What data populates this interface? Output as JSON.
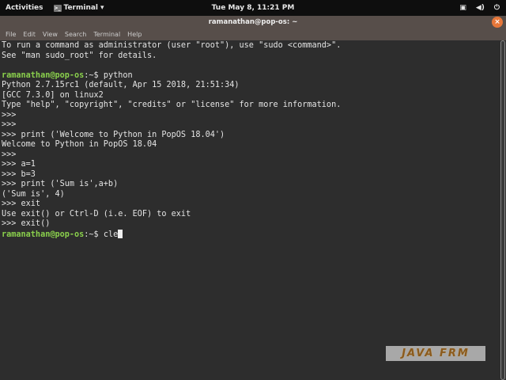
{
  "topbar": {
    "activities": "Activities",
    "app": "Terminal",
    "clock": "Tue May 8, 11:21 PM"
  },
  "window": {
    "title": "ramanathan@pop-os: ~",
    "close": "×"
  },
  "menu": [
    "File",
    "Edit",
    "View",
    "Search",
    "Terminal",
    "Help"
  ],
  "terminal": {
    "prompt": "ramanathan@pop-os",
    "lines": [
      "To run a command as administrator (user \"root\"), use \"sudo <command>\".",
      "See \"man sudo_root\" for details.",
      "",
      "Python 2.7.15rc1 (default, Apr 15 2018, 21:51:34)",
      "[GCC 7.3.0] on linux2",
      "Type \"help\", \"copyright\", \"credits\" or \"license\" for more information.",
      ">>> ",
      ">>> ",
      ">>> print ('Welcome to Python in PopOS 18.04')",
      "Welcome to Python in PopOS 18.04",
      ">>> ",
      ">>> a=1",
      ">>> b=3",
      ">>> print ('Sum is',a+b)",
      "('Sum is', 4)",
      ">>> exit",
      "Use exit() or Ctrl-D (i.e. EOF) to exit",
      ">>> exit()"
    ],
    "cmd1": "python",
    "cmd2": "cle",
    "prompt_suffix": ":~$ "
  },
  "watermark": "JAVA FRM"
}
